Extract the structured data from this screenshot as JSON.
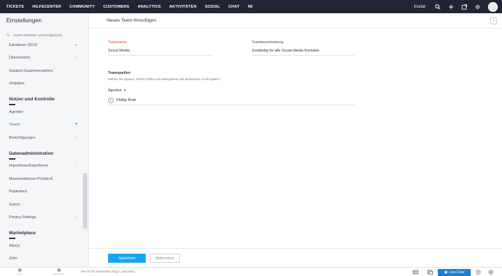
{
  "topnav": {
    "items": [
      "TICKETS",
      "HILFECENTER",
      "COMMUNITY",
      "CUSTOMERS",
      "ANALYTICS",
      "AKTIVITÄTEN",
      "SOZIAL",
      "CHAT",
      "IM"
    ],
    "org_name": "trustal",
    "icons": [
      "search-icon",
      "plus-icon",
      "external-window-icon",
      "gear-icon",
      "avatar"
    ]
  },
  "sidebar": {
    "title": "Einstellungen",
    "search_placeholder": "Suche einstellen und konfigurieren",
    "items": [
      {
        "label": "Eskalieren (DLV)",
        "chevron": false
      },
      {
        "label": "Überwachen",
        "chevron": true
      },
      {
        "label": "Support Zusammenziehen",
        "chevron": false
      },
      {
        "label": "Zeitpläne",
        "chevron": false
      }
    ],
    "sections": [
      {
        "title": "Nutzer und Kontrolle",
        "items": [
          {
            "label": "Agenten",
            "chevron": false
          },
          {
            "label": "Teams",
            "active": true
          },
          {
            "label": "Berechtigungen",
            "chevron": true
          }
        ]
      },
      {
        "title": "Datenadministration",
        "items": [
          {
            "label": "Importieren/Exportieren",
            "chevron": true
          },
          {
            "label": "Massenaktionen-Protokoll",
            "chevron": false
          },
          {
            "label": "Papierkorb",
            "chevron": false
          },
          {
            "label": "Zwitch",
            "chevron": false
          },
          {
            "label": "Privacy Settings",
            "chevron": true
          }
        ]
      },
      {
        "title": "Marketplace",
        "items": [
          {
            "label": "Alle(s)",
            "chevron": false
          },
          {
            "label": "Zoho",
            "chevron": false
          }
        ]
      }
    ]
  },
  "main": {
    "title": "Neues Team hinzufügen",
    "info_label": "i",
    "team_name_label": "Teamname",
    "team_name_value": "Social Media",
    "team_desc_label": "Teambeschreibung",
    "team_desc_value": "Zuständig für alle Social-Media Kontakte",
    "sources_title": "Teamquellen",
    "sources_desc": "Wählen Sie Agenten, Teams, Rollen und Untergebene zum Einbeziehen in die System.",
    "agents_label": "Agenten",
    "agents": [
      {
        "initial": "P",
        "name": "Phillip Roth"
      }
    ],
    "save_label": "Speichern",
    "cancel_label": "Abbrechen"
  },
  "bottombar": {
    "tabs": [
      {
        "label": "Home"
      },
      {
        "label": "Dashboard"
      }
    ],
    "search_placeholder": "Hier ist Ihr Sensechar (Strg + Leerzeile)",
    "live_chat_label": "Live-Chat"
  },
  "colors": {
    "nav_bg": "#1f2533",
    "accent": "#18a4f2",
    "link": "#1b7fcc",
    "required_label": "#e0492c"
  }
}
